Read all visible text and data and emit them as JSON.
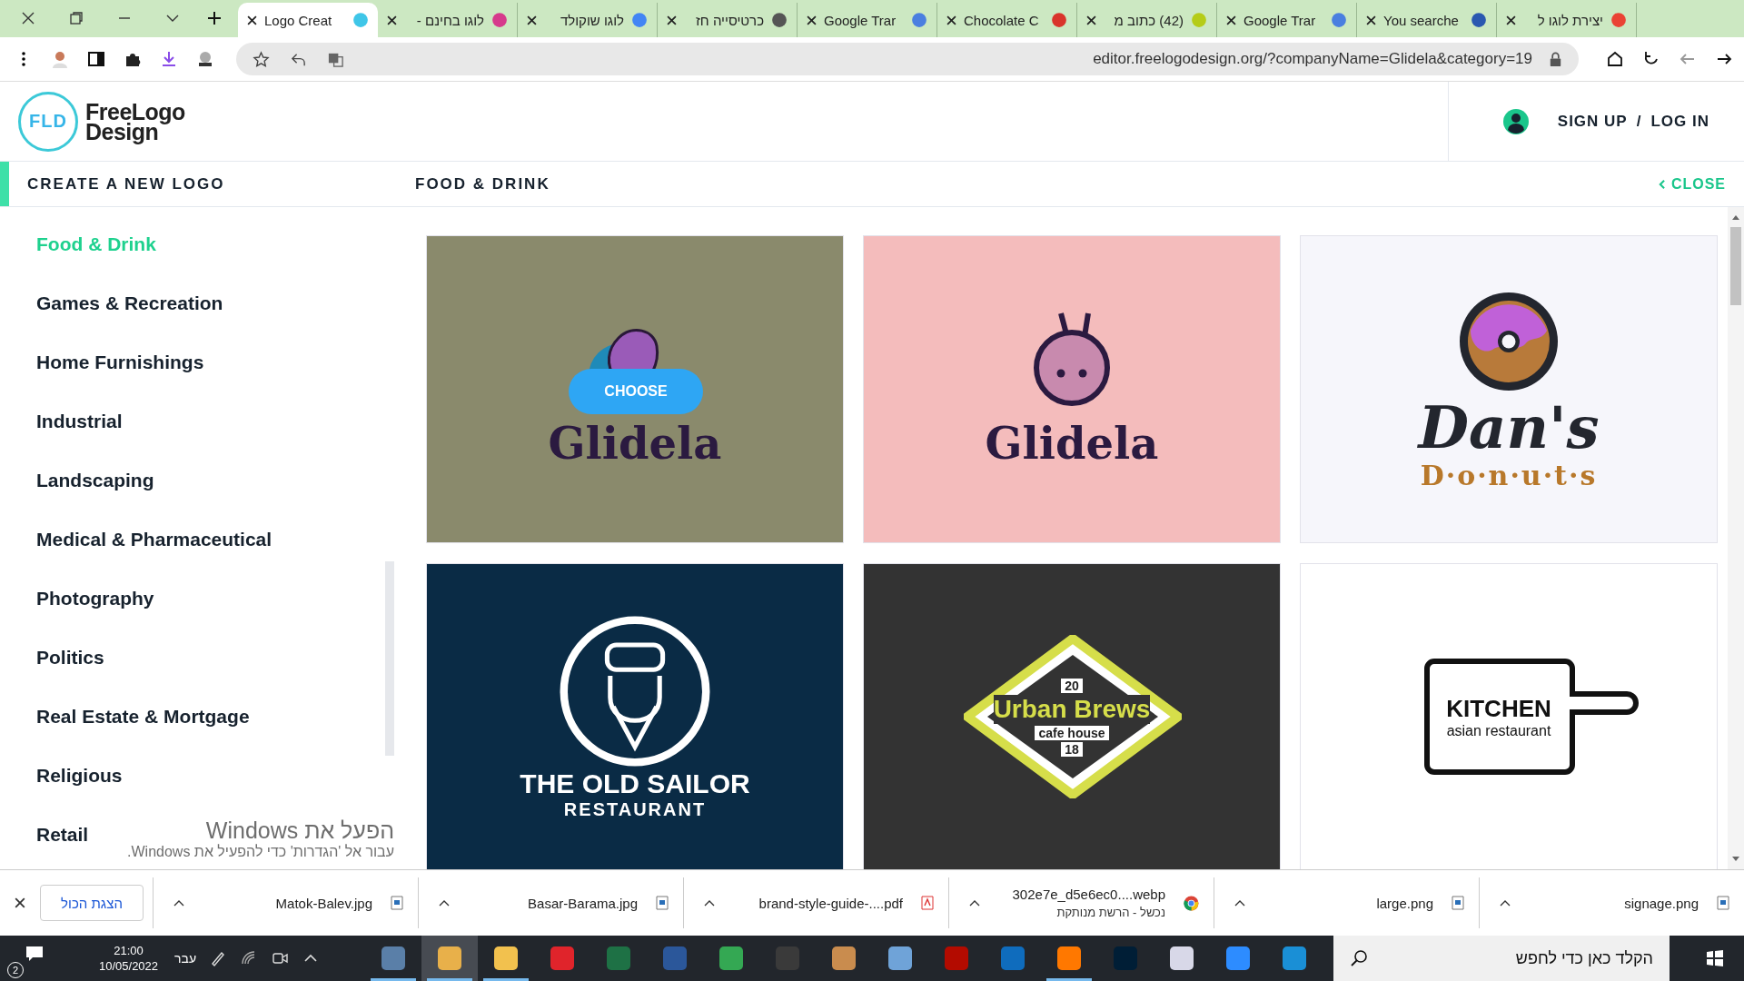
{
  "tabs": [
    {
      "label": "Logo Creat",
      "selected": true,
      "color": "#3fc6e8"
    },
    {
      "label": "לוגו בחינם -",
      "selected": false,
      "color": "#d63a8c"
    },
    {
      "label": "לוגו שוקולד",
      "selected": false,
      "color": "#4285f4"
    },
    {
      "label": "כרטיסייה חז",
      "selected": false,
      "color": "#555555"
    },
    {
      "label": "Google Trar",
      "selected": false,
      "color": "#4a7fe0"
    },
    {
      "label": "Chocolate C",
      "selected": false,
      "color": "#d9342b"
    },
    {
      "label": "(42) כתוב מ",
      "selected": false,
      "color": "#b5cc18"
    },
    {
      "label": "Google Trar",
      "selected": false,
      "color": "#4a7fe0"
    },
    {
      "label": "You searche",
      "selected": false,
      "color": "#2a58b0"
    },
    {
      "label": "יצירת לוגו ל",
      "selected": false,
      "color": "#ea4335"
    }
  ],
  "address_bar": {
    "url": "editor.freelogodesign.org/?companyName=Glidela&category=19"
  },
  "header": {
    "logo_mark": "FLD",
    "logo_line_1": "FreeLogo",
    "logo_line_2": "Design",
    "sign_up": "SIGN UP",
    "separator": "/",
    "log_in": "LOG IN"
  },
  "nav": {
    "title": "CREATE A NEW LOGO",
    "category": "FOOD & DRINK",
    "close": "CLOSE"
  },
  "sidebar": {
    "items": [
      {
        "label": "Food & Drink",
        "selected": true
      },
      {
        "label": "Games & Recreation",
        "selected": false
      },
      {
        "label": "Home Furnishings",
        "selected": false
      },
      {
        "label": "Industrial",
        "selected": false
      },
      {
        "label": "Landscaping",
        "selected": false
      },
      {
        "label": "Medical & Pharmaceutical",
        "selected": false
      },
      {
        "label": "Photography",
        "selected": false
      },
      {
        "label": "Politics",
        "selected": false
      },
      {
        "label": "Real Estate & Mortgage",
        "selected": false
      },
      {
        "label": "Religious",
        "selected": false
      },
      {
        "label": "Retail",
        "selected": false
      }
    ]
  },
  "logos": [
    {
      "kind": "ice-cream",
      "color": "#8a8a6c",
      "choose_button": "CHOOSE",
      "lines": [
        {
          "text": "Glidela",
          "kind": "brush"
        }
      ]
    },
    {
      "kind": "noodles",
      "color": "#f4bcbc",
      "lines": [
        {
          "text": "Glidela",
          "kind": "brush"
        }
      ]
    },
    {
      "kind": "donut",
      "color": "#f6f6fb",
      "lines": [
        {
          "text": "Dan's",
          "kind": "brush"
        },
        {
          "text": "D·o·n·u·t·s",
          "kind": "spaced"
        }
      ]
    },
    {
      "kind": "sailor",
      "color": "#0a2b45",
      "lines": [
        {
          "text": "THE OLD SAILOR",
          "kind": "title"
        },
        {
          "text": "RESTAURANT",
          "kind": "subtitle"
        }
      ]
    },
    {
      "kind": "badge",
      "color": "#333333",
      "lines": [
        {
          "text": "20",
          "kind": "small"
        },
        {
          "text": "Urban Brews",
          "kind": "title"
        },
        {
          "text": "cafe house",
          "kind": "small"
        },
        {
          "text": "18",
          "kind": "small"
        }
      ]
    },
    {
      "kind": "board",
      "color": "#ffffff",
      "lines": [
        {
          "text": "KITCHEN",
          "kind": "title"
        },
        {
          "text": "asian restaurant",
          "kind": "small"
        }
      ]
    }
  ],
  "activation_notice": {
    "title": "הפעל את Windows",
    "text": "עבור אל 'הגדרות' כדי להפעיל את Windows."
  },
  "downloads": {
    "show_all": "הצגת הכול",
    "items": [
      {
        "name": "Matok-Balev.jpg",
        "kind": "image"
      },
      {
        "name": "Basar-Barama.jpg",
        "kind": "image"
      },
      {
        "name": "brand-style-guide-....pdf",
        "kind": "pdf"
      },
      {
        "name": "302e7e_d5e6ec0....webp",
        "kind": "web",
        "status": "נכשל - הרשת מנותקת"
      },
      {
        "name": "large.png",
        "kind": "image"
      },
      {
        "name": "signage.png",
        "kind": "image"
      }
    ]
  },
  "taskbar": {
    "notifications": "2",
    "time": "21:00",
    "date": "10/05/2022",
    "language": "עבר",
    "search_placeholder": "הקלד כאן כדי לחפש",
    "apps": [
      {
        "color": "#5a7fa8",
        "running": true,
        "selected": false
      },
      {
        "color": "#e8b04a",
        "running": true,
        "selected": true
      },
      {
        "color": "#f2c14e",
        "running": true,
        "selected": false
      },
      {
        "color": "#e0242b",
        "running": false,
        "selected": false
      },
      {
        "color": "#1e7145",
        "running": false,
        "selected": false
      },
      {
        "color": "#2b579a",
        "running": false,
        "selected": false
      },
      {
        "color": "#34a853",
        "running": false,
        "selected": false
      },
      {
        "color": "#3a3a3a",
        "running": false,
        "selected": false
      },
      {
        "color": "#c98c4e",
        "running": false,
        "selected": false
      },
      {
        "color": "#6fa3d8",
        "running": false,
        "selected": false
      },
      {
        "color": "#b30b00",
        "running": false,
        "selected": false
      },
      {
        "color": "#0f6cbd",
        "running": false,
        "selected": false
      },
      {
        "color": "#ff7800",
        "running": true,
        "selected": false
      },
      {
        "color": "#001e36",
        "running": false,
        "selected": false
      },
      {
        "color": "#d8d8e8",
        "running": false,
        "selected": false
      },
      {
        "color": "#2d8cff",
        "running": false,
        "selected": false
      },
      {
        "color": "#1a8fd6",
        "running": false,
        "selected": false
      }
    ]
  }
}
